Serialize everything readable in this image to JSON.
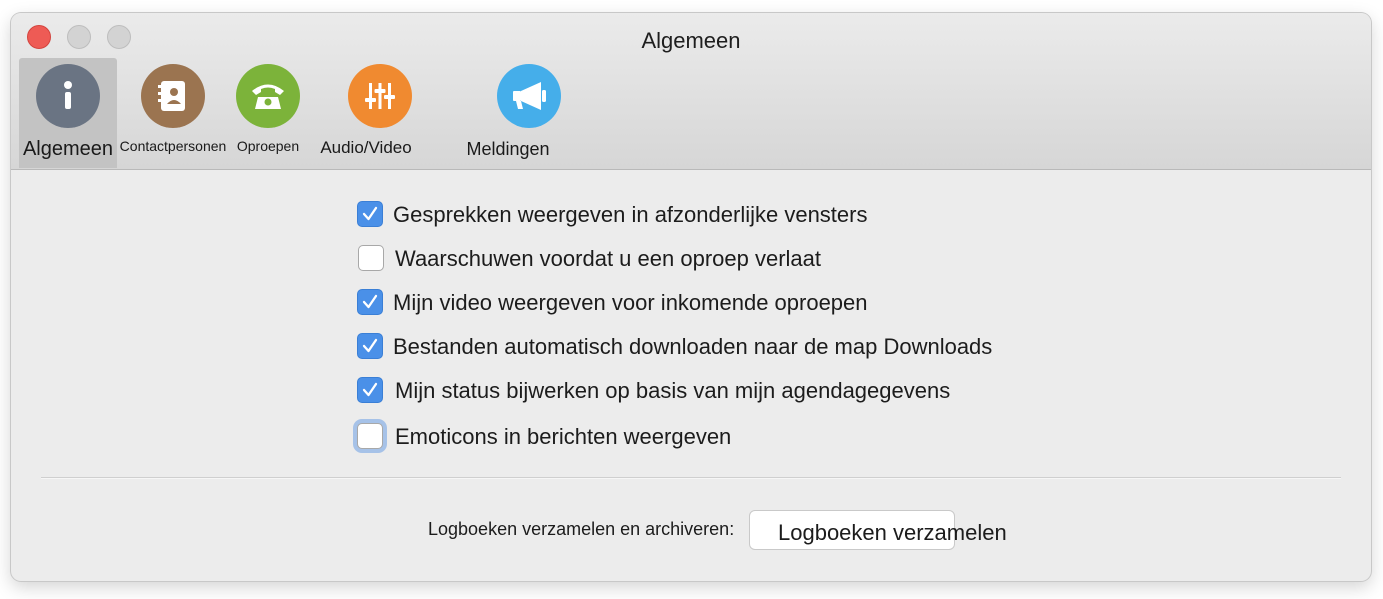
{
  "window": {
    "title": "Algemeen"
  },
  "toolbar": {
    "tabs": [
      {
        "label": "Algemeen",
        "icon": "info-icon",
        "color": "#6a7483",
        "selected": true
      },
      {
        "label": "Contactpersonen",
        "icon": "address-book-icon",
        "color": "#9b7450",
        "selected": false
      },
      {
        "label": "Oproepen",
        "icon": "telephone-icon",
        "color": "#7cb33a",
        "selected": false
      },
      {
        "label": "Audio/Video",
        "icon": "sliders-icon",
        "color": "#f08a30",
        "selected": false
      },
      {
        "label": "Meldingen",
        "icon": "megaphone-icon",
        "color": "#45aeea",
        "selected": false
      }
    ]
  },
  "options": [
    {
      "label": "Gesprekken weergeven in afzonderlijke vensters",
      "checked": true
    },
    {
      "label": "Waarschuwen voordat u een oproep verlaat",
      "checked": false
    },
    {
      "label": "Mijn video weergeven voor inkomende oproepen",
      "checked": true
    },
    {
      "label": "Bestanden automatisch downloaden naar de map Downloads",
      "checked": true
    },
    {
      "label": "Mijn status bijwerken op basis van mijn agendagegevens",
      "checked": true
    },
    {
      "label": "Emoticons in berichten weergeven",
      "checked": false,
      "focused": true
    }
  ],
  "logs": {
    "label": "Logboeken verzamelen en archiveren:",
    "button_label": "Logboeken verzamelen"
  },
  "colors": {
    "accent": "#4a90e8",
    "close": "#ee5b55"
  }
}
